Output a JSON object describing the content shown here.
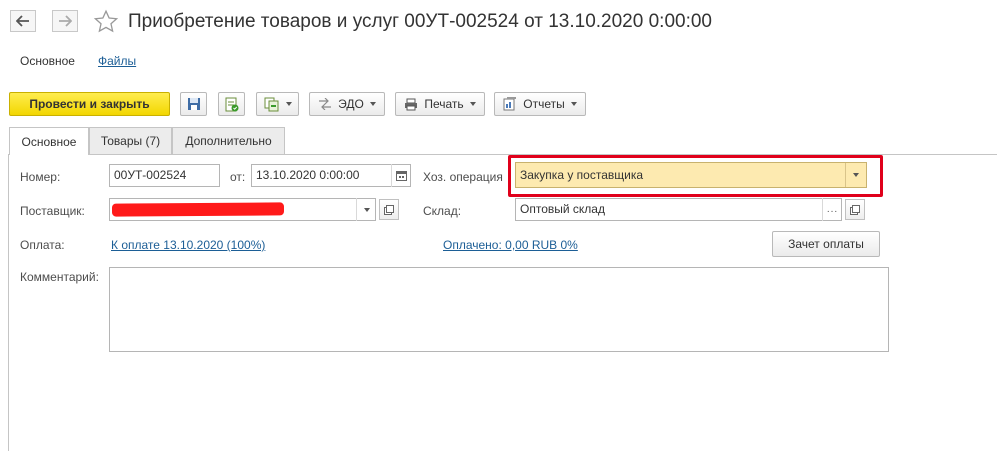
{
  "window": {
    "title": "Приобретение товаров и услуг 00УТ-002524 от 13.10.2020 0:00:00"
  },
  "top_nav": {
    "main": "Основное",
    "files": "Файлы"
  },
  "toolbar": {
    "post_close": "Провести и закрыть",
    "edo": "ЭДО",
    "print": "Печать",
    "reports": "Отчеты"
  },
  "tabs": [
    {
      "label": "Основное"
    },
    {
      "label": "Товары (7)"
    },
    {
      "label": "Дополнительно"
    }
  ],
  "form": {
    "number_label": "Номер:",
    "number_value": "00УТ-002524",
    "date_label": "от:",
    "date_value": "13.10.2020  0:00:00",
    "operation_label": "Хоз. операция",
    "operation_value": "Закупка у поставщика",
    "supplier_label": "Поставщик:",
    "warehouse_label": "Склад:",
    "warehouse_value": "Оптовый склад",
    "payment_label": "Оплата:",
    "payment_link": "К оплате 13.10.2020 (100%)",
    "paid_link": "Оплачено: 0,00 RUB  0%",
    "offset_button": "Зачет оплаты",
    "comment_label": "Комментарий:"
  },
  "colors": {
    "primary_button": "#f2d600",
    "highlight": "#fdeab0",
    "annotation_frame": "#e0001b",
    "link": "#1c5e96"
  }
}
